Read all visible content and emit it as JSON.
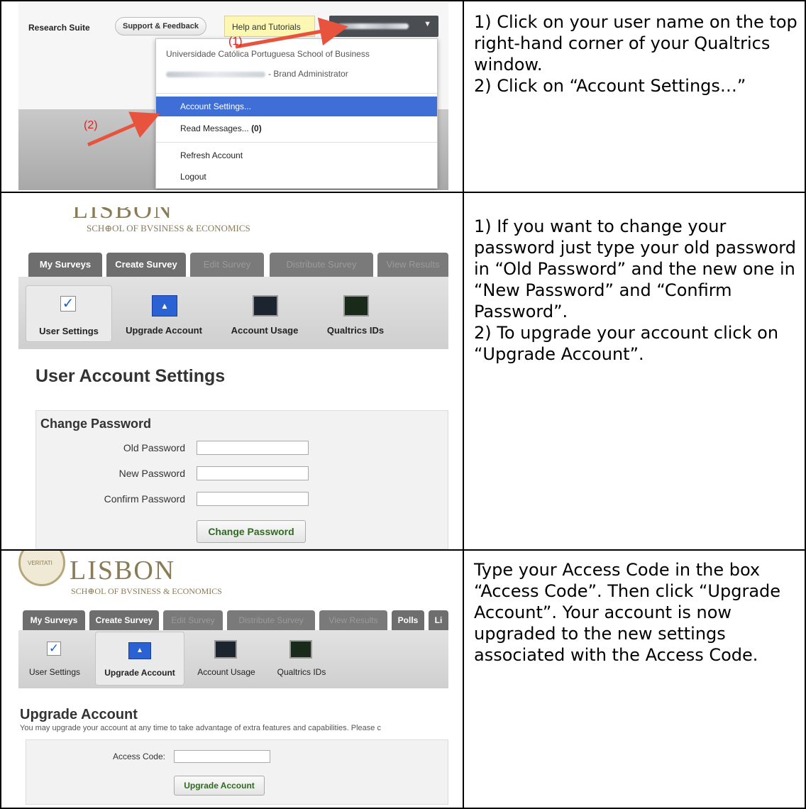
{
  "rows": [
    {
      "instructions": [
        "1) Click on your user name on the top right-hand corner of your Qualtrics window.",
        "2) Click on “Account Settings…”"
      ],
      "screenshot": {
        "app_name": "Research Suite",
        "support_button": "Support & Feedback",
        "help_button": "Help and Tutorials",
        "user_menu": {
          "organization": "Universidade Católica Portuguesa School of Business",
          "role": "- Brand Administrator",
          "items": [
            "Account Settings...",
            "Read Messages...",
            "Refresh Account",
            "Logout"
          ],
          "message_count": "(0)",
          "selected_item": "Account Settings..."
        },
        "annotations": [
          "(1)",
          "(2)"
        ],
        "annotation_color": "#e02020"
      }
    },
    {
      "instructions": [
        "1) If you want to change your password just type your old password in “Old Password” and the new one in “New Password” and “Confirm Password”.",
        "2) To upgrade your account click on “Upgrade Account”."
      ],
      "screenshot": {
        "logo_text": "LISBON",
        "logo_subtitle": "SCH⊕OL OF BVSINESS & ECONOMICS",
        "tabs": [
          "My Surveys",
          "Create Survey",
          "Edit Survey",
          "Distribute Survey",
          "View Results"
        ],
        "subnav": [
          "User Settings",
          "Upgrade Account",
          "Account Usage",
          "Qualtrics IDs"
        ],
        "page_title": "User Account Settings",
        "section_title": "Change Password",
        "fields": [
          "Old Password",
          "New Password",
          "Confirm Password"
        ],
        "submit_button": "Change Password"
      }
    },
    {
      "instructions": [
        "Type your Access Code in the box “Access Code”. Then click “Upgrade Account”. Your account is now upgraded to the new settings associated with the Access Code."
      ],
      "screenshot": {
        "logo_text": "LISBON",
        "logo_subtitle": "SCH⊕OL OF BVSINESS & ECONOMICS",
        "seal_text": "VERITATI",
        "tabs": [
          "My Surveys",
          "Create Survey",
          "Edit Survey",
          "Distribute Survey",
          "View Results",
          "Polls",
          "Li"
        ],
        "subnav": [
          "User Settings",
          "Upgrade Account",
          "Account Usage",
          "Qualtrics IDs"
        ],
        "page_title": "Upgrade Account",
        "description": "You may upgrade your account at any time to take advantage of extra features and capabilities. Please c",
        "field": "Access Code:",
        "submit_button": "Upgrade Account"
      }
    }
  ]
}
